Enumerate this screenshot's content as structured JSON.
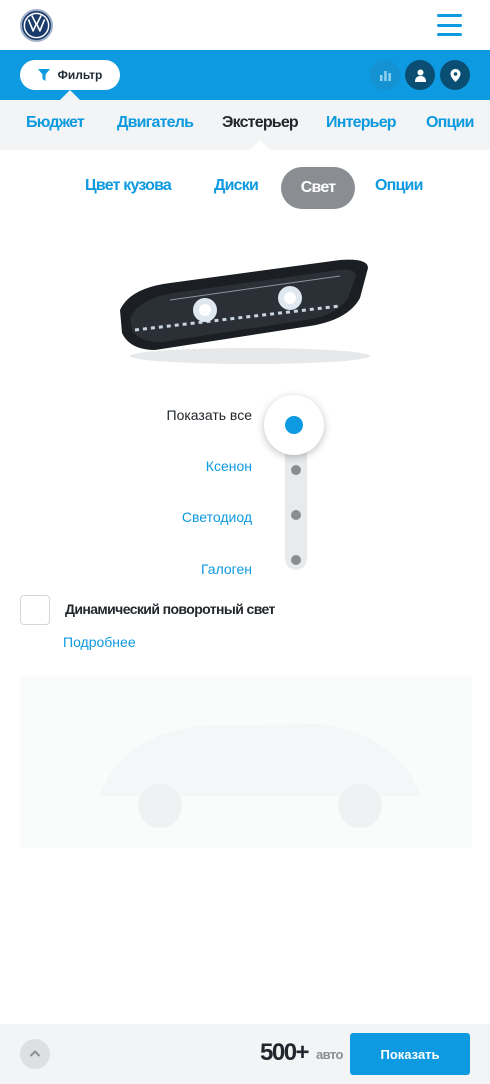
{
  "header": {
    "logo": "vw-logo",
    "menu_icon": "hamburger-menu-icon"
  },
  "filterbar": {
    "filter_label": "Фильтр",
    "icons": [
      "chart-icon",
      "user-icon",
      "location-pin-icon"
    ]
  },
  "categories": {
    "items": [
      "Бюджет",
      "Двигатель",
      "Экстерьер",
      "Интерьер",
      "Опции"
    ],
    "active": "Экстерьер"
  },
  "subtabs": {
    "items": [
      "Цвет кузова",
      "Диски",
      "Свет",
      "Опции"
    ],
    "active": "Свет"
  },
  "lights": {
    "options": [
      "Показать все",
      "Ксенон",
      "Светодиод",
      "Галоген"
    ],
    "selected": "Показать все"
  },
  "dynamic_light": {
    "label": "Динамический поворотный свет",
    "checked": false,
    "more_link": "Подробнее"
  },
  "footer": {
    "count": "500+",
    "count_unit": "авто",
    "show_button": "Показать"
  },
  "colors": {
    "accent": "#0d9ae0",
    "dark_blue": "#0a4f73",
    "text": "#22272d",
    "grey": "#8a8e93",
    "panel": "#f2f4f5"
  }
}
